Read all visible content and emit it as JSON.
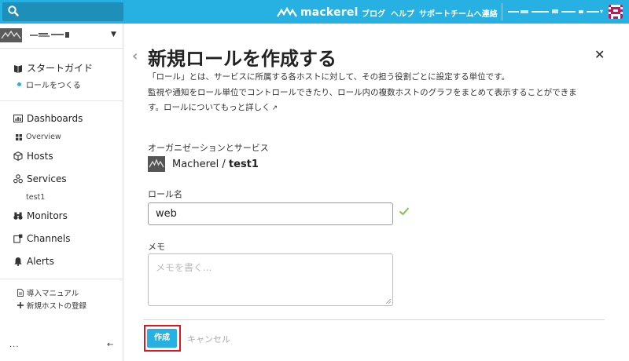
{
  "header": {
    "brand": "mackerel",
    "nav": [
      "ブログ",
      "ヘルプ",
      "サポートチームへ連絡"
    ],
    "icons": [
      "search-icon",
      "mackerel-logo-icon",
      "user-avatar"
    ]
  },
  "sidebar": {
    "guide_title": "スタートガイド",
    "guide_step": "ロールをつくる",
    "items": [
      {
        "label": "Dashboards",
        "icon": "dashboard-icon"
      },
      {
        "label": "Overview",
        "icon": "grid-icon"
      },
      {
        "label": "Hosts",
        "icon": "cube-icon"
      },
      {
        "label": "Services",
        "icon": "services-icon"
      },
      {
        "label": "test1"
      },
      {
        "label": "Monitors",
        "icon": "binoculars-icon"
      },
      {
        "label": "Channels",
        "icon": "channels-icon"
      },
      {
        "label": "Alerts",
        "icon": "bell-icon"
      }
    ],
    "bottom_links": [
      {
        "label": "導入マニュアル",
        "icon": "document-icon"
      },
      {
        "label": "新規ホストの登録",
        "icon": "plus-icon"
      }
    ],
    "more_label": "...",
    "collapse_label": "←"
  },
  "main": {
    "title": "新規ロールを作成する",
    "description": [
      "「ロール」とは、サービスに所属する各ホストに対して、その担う役割ごとに設定する単位です。",
      "監視や通知をロール単位でコントロールできたり、ロール内の複数ホストのグラフをまとめて表示することができま",
      "す。ロールについてもっと詳しく"
    ],
    "service_label": "オーガニゼーションとサービス",
    "org_name": "Macherel",
    "separator": " / ",
    "service_name": "test1",
    "role_name_label": "ロール名",
    "role_name_value": "web",
    "memo_label": "メモ",
    "memo_placeholder": "メモを書く...",
    "create_button": "作成",
    "cancel_button": "キャンセル"
  },
  "colors": {
    "accent": "#27b1e3",
    "highlight": "#e0161c",
    "check": "#7ac943"
  }
}
